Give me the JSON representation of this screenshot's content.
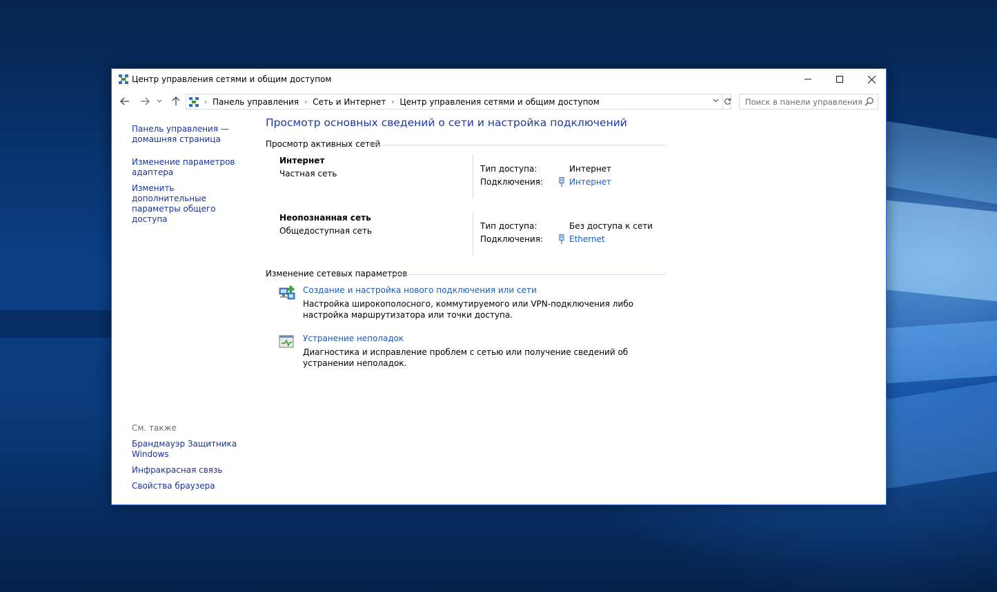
{
  "window": {
    "title": "Центр управления сетями и общим доступом",
    "minimize_label": "—",
    "maximize_label": "☐",
    "close_label": "✕"
  },
  "navbar": {
    "breadcrumbs": [
      "Панель управления",
      "Сеть и Интернет",
      "Центр управления сетями и общим доступом"
    ],
    "search_placeholder": "Поиск в панели управления"
  },
  "sidebar": {
    "links": [
      "Панель управления — домашняя страница",
      "Изменение параметров адаптера",
      "Изменить дополнительные параметры общего доступа"
    ],
    "see_also_label": "См. также",
    "see_also_links": [
      "Брандмауэр Защитника Windows",
      "Инфракрасная связь",
      "Свойства браузера"
    ]
  },
  "main": {
    "title": "Просмотр основных сведений о сети и настройка подключений",
    "active_networks_heading": "Просмотр активных сетей",
    "networks": [
      {
        "name": "Интернет",
        "type": "Частная сеть",
        "access_label": "Тип доступа:",
        "access_value": "Интернет",
        "connections_label": "Подключения:",
        "connection_name": "Интернет"
      },
      {
        "name": "Неопознанная сеть",
        "type": "Общедоступная сеть",
        "access_label": "Тип доступа:",
        "access_value": "Без доступа к сети",
        "connections_label": "Подключения:",
        "connection_name": "Ethernet"
      }
    ],
    "change_settings_heading": "Изменение сетевых параметров",
    "tasks": [
      {
        "title": "Создание и настройка нового подключения или сети",
        "description": "Настройка широкополосного, коммутируемого или VPN-подключения либо настройка маршрутизатора или точки доступа."
      },
      {
        "title": "Устранение неполадок",
        "description": "Диагностика и исправление проблем с сетью или получение сведений об устранении неполадок."
      }
    ]
  },
  "colors": {
    "link": "#1a5bbf",
    "sidebar_link": "#1a3399",
    "title": "#1e3b9a",
    "window_border": "#2b6fc7"
  }
}
